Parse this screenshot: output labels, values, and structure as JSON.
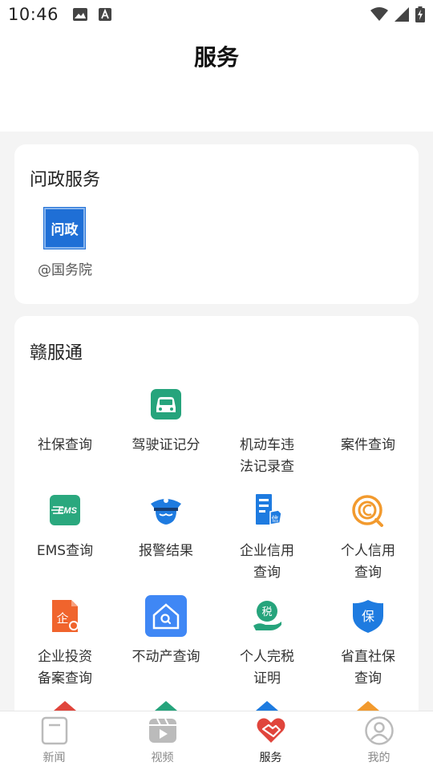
{
  "status_bar": {
    "time": "10:46",
    "left_icons": [
      "image-icon",
      "a-icon"
    ],
    "right_icons": [
      "wifi-icon",
      "signal-icon",
      "battery-charging-icon"
    ]
  },
  "header": {
    "title": "服务"
  },
  "wenzheng_section": {
    "title": "问政服务",
    "item": {
      "icon_text": "问政",
      "label": "@国务院",
      "color": "#1f6fd6"
    }
  },
  "ganfutong_section": {
    "title": "赣服通",
    "items": [
      {
        "label": "社保查询",
        "icon": "none"
      },
      {
        "label": "驾驶证记分",
        "icon": "car-icon",
        "color": "#26a47c"
      },
      {
        "label": "机动车违\n法记录查",
        "icon": "none"
      },
      {
        "label": "案件查询",
        "icon": "none"
      },
      {
        "label": "EMS查询",
        "icon": "ems-icon",
        "icon_text": "EMS",
        "color": "#2aa87e"
      },
      {
        "label": "报警结果",
        "icon": "police-icon",
        "color": "#1e7be0"
      },
      {
        "label": "企业信用\n查询",
        "icon": "enterprise-credit-icon",
        "icon_text": "信",
        "color": "#1e7be0"
      },
      {
        "label": "个人信用\n查询",
        "icon": "personal-credit-icon",
        "color": "#f29a2e"
      },
      {
        "label": "企业投资\n备案查询",
        "icon": "enterprise-investment-icon",
        "icon_text": "企",
        "color": "#f0642d"
      },
      {
        "label": "不动产查询",
        "icon": "real-estate-icon",
        "color": "#3f87f5"
      },
      {
        "label": "个人完税\n证明",
        "icon": "tax-icon",
        "icon_text": "税",
        "color": "#26a47c"
      },
      {
        "label": "省直社保\n查询",
        "icon": "social-security-shield-icon",
        "icon_text": "保",
        "color": "#1e7be0"
      }
    ],
    "partial_row_colors": [
      "#e0453c",
      "#26a47c",
      "#1e7be0",
      "#f29a2e"
    ]
  },
  "tabbar": {
    "tabs": [
      {
        "label": "新闻",
        "icon": "news-icon",
        "active": false
      },
      {
        "label": "视频",
        "icon": "video-icon",
        "active": false
      },
      {
        "label": "服务",
        "icon": "service-handshake-icon",
        "active": true,
        "color": "#e0453c"
      },
      {
        "label": "我的",
        "icon": "profile-icon",
        "active": false
      }
    ]
  }
}
